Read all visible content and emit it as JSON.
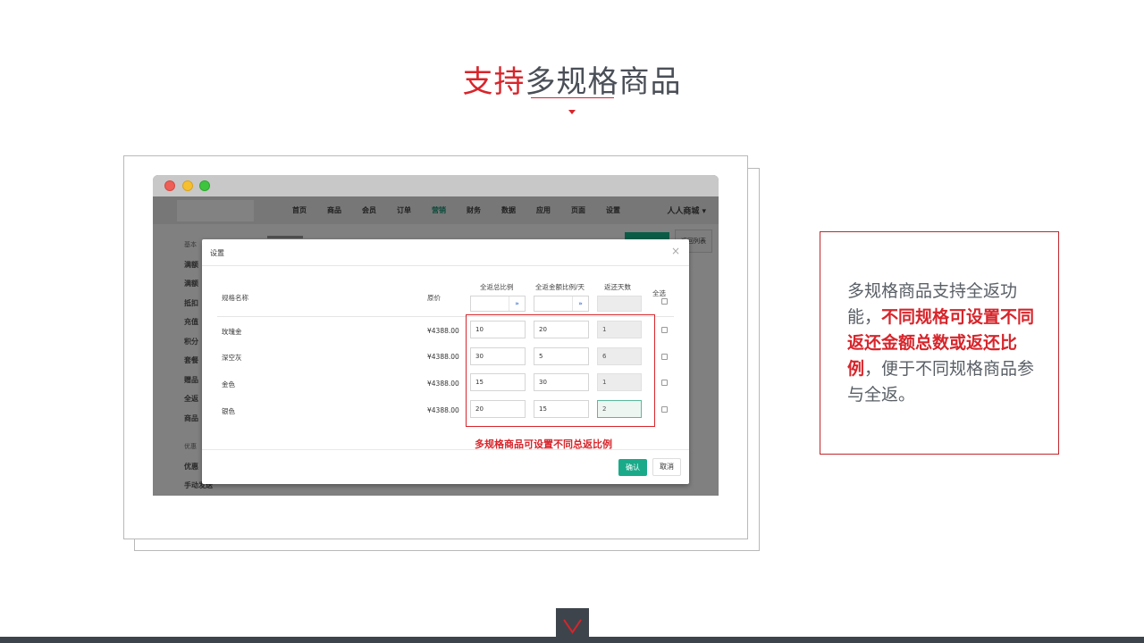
{
  "slide": {
    "title_red": "支持",
    "title_dark": "多规格商品"
  },
  "browser": {
    "nav": [
      "首页",
      "商品",
      "会员",
      "订单",
      "营销",
      "财务",
      "数据",
      "应用",
      "页面",
      "设置"
    ],
    "active_nav": "营销",
    "shop_name": "人人商城",
    "sidebar": {
      "group1": "基本",
      "items1": [
        "满额",
        "满额",
        "抵扣",
        "充值",
        "积分",
        "套餐",
        "赠品",
        "全返",
        "商品"
      ],
      "group2": "优惠",
      "items2": [
        "优惠",
        "手动发送"
      ]
    },
    "header_button": "返回列表"
  },
  "modal": {
    "title": "设置",
    "close": "×",
    "columns": {
      "name": "规格名称",
      "price": "原价",
      "total_ratio": "全返总比例",
      "amount_ratio": "全返金额比例/天",
      "days": "返还天数",
      "select_all": "全选"
    },
    "rows": [
      {
        "name": "玫瑰金",
        "price": "¥4388.00",
        "total_ratio": "10",
        "amount_ratio": "20",
        "days": "1"
      },
      {
        "name": "深空灰",
        "price": "¥4388.00",
        "total_ratio": "30",
        "amount_ratio": "5",
        "days": "6"
      },
      {
        "name": "金色",
        "price": "¥4388.00",
        "total_ratio": "15",
        "amount_ratio": "30",
        "days": "1"
      },
      {
        "name": "银色",
        "price": "¥4388.00",
        "total_ratio": "20",
        "amount_ratio": "15",
        "days": "2"
      }
    ],
    "highlight_note": "多规格商品可设置不同总返比例",
    "confirm": "确认",
    "cancel": "取消"
  },
  "description": {
    "part1": "多规格商品支持全返功能，",
    "emphasis": "不同规格可设置不同返还金额总数或返还比例",
    "part2": "，便于不同规格商品参与全返。"
  },
  "colors": {
    "accent_red": "#d7252b",
    "dark_slate": "#3e444c",
    "confirm_green": "#1aaa8a"
  }
}
